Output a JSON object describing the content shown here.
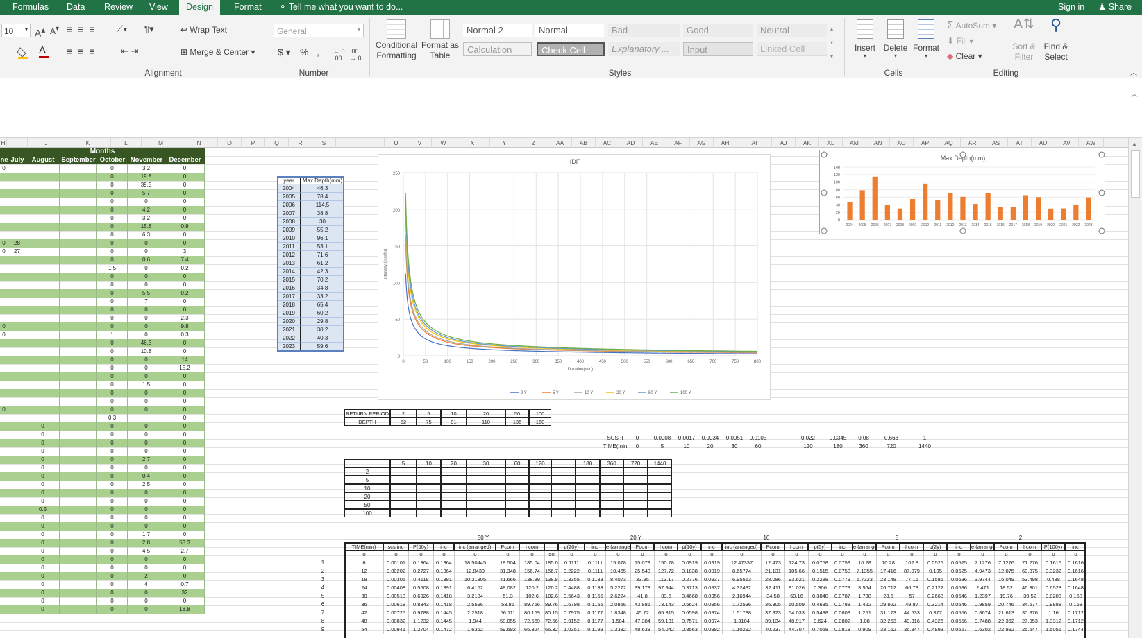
{
  "tabs": [
    "Formulas",
    "Data",
    "Review",
    "View",
    "Design",
    "Format"
  ],
  "tell_me": "Tell me what you want to do...",
  "sign_in": "Sign in",
  "share": "Share",
  "ribbon": {
    "font_size": "10",
    "wrap_text": "Wrap Text",
    "merge_center": "Merge & Center",
    "number_format": "General",
    "cond_format": [
      "Conditional",
      "Formatting"
    ],
    "format_table": [
      "Format as",
      "Table"
    ],
    "insert": "Insert",
    "delete": "Delete",
    "format": "Format",
    "autosum": "AutoSum",
    "fill": "Fill",
    "clear": "Clear",
    "sort_filter": [
      "Sort &",
      "Filter"
    ],
    "find_select": [
      "Find &",
      "Select"
    ],
    "groups": {
      "alignment": "Alignment",
      "number": "Number",
      "styles": "Styles",
      "cells": "Cells",
      "editing": "Editing"
    },
    "styles": [
      [
        "Normal 2",
        "Normal",
        "Bad",
        "Good",
        "Neutral"
      ],
      [
        "Calculation",
        "Check Cell",
        "Explanatory ...",
        "Input",
        "Linked Cell"
      ]
    ],
    "colors": {
      "bad": "#ffc7ce",
      "good": "#c6efce",
      "neutral": "#ffeb9c",
      "check": "#a5a5a5",
      "fill_icon": "#ffc000",
      "font_icon": "#c00000"
    }
  },
  "columns": [
    "H",
    "I",
    "J",
    "K",
    "L",
    "M",
    "N",
    "O",
    "P",
    "Q",
    "R",
    "S",
    "T",
    "U",
    "V",
    "W",
    "X",
    "Y",
    "Z",
    "AA",
    "AB",
    "AC",
    "AD",
    "AE",
    "AF",
    "AG",
    "AH",
    "AI",
    "AJ",
    "AK",
    "AL",
    "AM",
    "AN",
    "AO",
    "AP",
    "AQ",
    "AR",
    "AS",
    "AT",
    "AU",
    "AV",
    "AW"
  ],
  "months_table": {
    "title": "Months",
    "headers": [
      "ne",
      "July",
      "August",
      "September",
      "October",
      "November",
      "December"
    ],
    "rows": [
      [
        "0",
        "",
        "",
        "",
        "0",
        "3.2",
        "0"
      ],
      [
        "",
        "",
        "",
        "",
        "0",
        "19.8",
        "0"
      ],
      [
        "",
        "",
        "",
        "",
        "0",
        "39.5",
        "0"
      ],
      [
        "",
        "",
        "",
        "",
        "0",
        "5.7",
        "0"
      ],
      [
        "",
        "",
        "",
        "",
        "0",
        "0",
        "0"
      ],
      [
        "",
        "",
        "",
        "",
        "0",
        "4.2",
        "0"
      ],
      [
        "",
        "",
        "",
        "",
        "0",
        "3.2",
        "0"
      ],
      [
        "",
        "",
        "",
        "",
        "0",
        "15.8",
        "0.9"
      ],
      [
        "",
        "",
        "",
        "",
        "0",
        "6.3",
        "0"
      ],
      [
        "0",
        "28",
        "",
        "",
        "0",
        "0",
        "0"
      ],
      [
        "0",
        "27",
        "",
        "",
        "0",
        "0",
        "3"
      ],
      [
        "",
        "",
        "",
        "",
        "0",
        "0.6",
        "7.4"
      ],
      [
        "",
        "",
        "",
        "",
        "1.5",
        "0",
        "0.2"
      ],
      [
        "",
        "",
        "",
        "",
        "0",
        "0",
        "0"
      ],
      [
        "",
        "",
        "",
        "",
        "0",
        "0",
        "0"
      ],
      [
        "",
        "",
        "",
        "",
        "0",
        "5.5",
        "0.2"
      ],
      [
        "",
        "",
        "",
        "",
        "0",
        "7",
        "0"
      ],
      [
        "",
        "",
        "",
        "",
        "0",
        "0",
        "0"
      ],
      [
        "",
        "",
        "",
        "",
        "0",
        "0",
        "2.3"
      ],
      [
        "0",
        "",
        "",
        "",
        "0",
        "0",
        "9.8"
      ],
      [
        "0",
        "",
        "",
        "",
        "1",
        "0",
        "0.3"
      ],
      [
        "",
        "",
        "",
        "",
        "0",
        "46.3",
        "0"
      ],
      [
        "",
        "",
        "",
        "",
        "0",
        "10.8",
        "0"
      ],
      [
        "",
        "",
        "",
        "",
        "0",
        "0",
        "14"
      ],
      [
        "",
        "",
        "",
        "",
        "0",
        "0",
        "15.2"
      ],
      [
        "",
        "",
        "",
        "",
        "0",
        "0",
        "0"
      ],
      [
        "",
        "",
        "",
        "",
        "0",
        "1.5",
        "0"
      ],
      [
        "",
        "",
        "",
        "",
        "0",
        "0",
        "0"
      ],
      [
        "",
        "",
        "",
        "",
        "0",
        "0",
        "0"
      ],
      [
        "0",
        "",
        "",
        "",
        "0",
        "0",
        "0"
      ],
      [
        "",
        "",
        "",
        "",
        "0.3",
        "",
        "0"
      ],
      [
        "",
        "",
        "0",
        "",
        "0",
        "0",
        "0"
      ],
      [
        "",
        "",
        "0",
        "",
        "0",
        "0",
        "0"
      ],
      [
        "",
        "",
        "0",
        "",
        "0",
        "0",
        "0"
      ],
      [
        "",
        "",
        "0",
        "",
        "0",
        "0",
        "0"
      ],
      [
        "",
        "",
        "0",
        "",
        "0",
        "2.7",
        "0"
      ],
      [
        "",
        "",
        "0",
        "",
        "0",
        "0",
        "0"
      ],
      [
        "",
        "",
        "0",
        "",
        "0",
        "0.4",
        "0"
      ],
      [
        "",
        "",
        "0",
        "",
        "0",
        "2.5",
        "0"
      ],
      [
        "",
        "",
        "0",
        "",
        "0",
        "0",
        "0"
      ],
      [
        "",
        "",
        "0",
        "",
        "0",
        "0",
        "0"
      ],
      [
        "",
        "",
        "0.5",
        "",
        "0",
        "0",
        "0"
      ],
      [
        "",
        "",
        "0",
        "",
        "0",
        "0",
        "0"
      ],
      [
        "",
        "",
        "0",
        "",
        "0",
        "0",
        "0"
      ],
      [
        "",
        "",
        "0",
        "",
        "0",
        "1.7",
        "0"
      ],
      [
        "",
        "",
        "0",
        "",
        "0",
        "2.8",
        "53.3"
      ],
      [
        "",
        "",
        "0",
        "",
        "0",
        "4.5",
        "2.7"
      ],
      [
        "",
        "",
        "0",
        "",
        "0",
        "0",
        "0"
      ],
      [
        "",
        "",
        "0",
        "",
        "0",
        "0",
        "0"
      ],
      [
        "",
        "",
        "0",
        "",
        "0",
        "2",
        "0"
      ],
      [
        "",
        "",
        "0",
        "",
        "0",
        "4",
        "0.7"
      ],
      [
        "",
        "",
        "0",
        "",
        "0",
        "0",
        "32"
      ],
      [
        "",
        "",
        "0",
        "",
        "0",
        "0",
        "0"
      ],
      [
        "",
        "",
        "0",
        "",
        "0",
        "0",
        "18.8"
      ]
    ]
  },
  "maxdepth_table": {
    "headers": [
      "year",
      "Max Depth(mm)"
    ],
    "rows": [
      [
        "2004",
        "46.3"
      ],
      [
        "2005",
        "78.4"
      ],
      [
        "2006",
        "114.5"
      ],
      [
        "2007",
        "38.8"
      ],
      [
        "2008",
        "30"
      ],
      [
        "2009",
        "55.2"
      ],
      [
        "2010",
        "96.1"
      ],
      [
        "2011",
        "53.1"
      ],
      [
        "2012",
        "71.6"
      ],
      [
        "2013",
        "61.2"
      ],
      [
        "2014",
        "42.3"
      ],
      [
        "2015",
        "70.2"
      ],
      [
        "2016",
        "34.8"
      ],
      [
        "2017",
        "33.2"
      ],
      [
        "2018",
        "65.4"
      ],
      [
        "2019",
        "60.2"
      ],
      [
        "2020",
        "29.8"
      ],
      [
        "2021",
        "30.2"
      ],
      [
        "2022",
        "40.3"
      ],
      [
        "2023",
        "59.6"
      ]
    ]
  },
  "chart_data": [
    {
      "type": "line",
      "title": "IDF",
      "xlabel": "Duration(min)",
      "ylabel": "Intensity (mm/hr)",
      "xlim": [
        0,
        800
      ],
      "ylim": [
        0,
        250
      ],
      "x": [
        5,
        10,
        20,
        30,
        60,
        120,
        180,
        360,
        720,
        1440
      ],
      "series": [
        {
          "name": "2 Y",
          "color": "#4472c4",
          "values": [
            112,
            72,
            45,
            34,
            20,
            12,
            9,
            5.5,
            3,
            1.5
          ]
        },
        {
          "name": "5 Y",
          "color": "#ed7d31",
          "values": [
            155,
            99,
            62,
            47,
            28,
            16,
            12,
            7.5,
            4.5,
            2.5
          ]
        },
        {
          "name": "10 Y",
          "color": "#a5a5a5",
          "values": [
            165,
            106,
            67,
            50,
            30,
            17.5,
            13,
            8,
            5,
            2.7
          ]
        },
        {
          "name": "20 Y",
          "color": "#ffc000",
          "values": [
            190,
            122,
            77,
            58,
            34,
            20,
            15,
            9.3,
            5.7,
            3.1
          ]
        },
        {
          "name": "50 Y",
          "color": "#5b9bd5",
          "values": [
            205,
            132,
            83,
            62,
            37,
            21.5,
            16,
            10,
            6.2,
            3.4
          ]
        },
        {
          "name": "100 Y",
          "color": "#70ad47",
          "values": [
            222,
            143,
            90,
            67,
            40,
            23.5,
            17.5,
            11,
            6.7,
            3.7
          ]
        }
      ]
    },
    {
      "type": "bar",
      "title": "Max Depth(mm)",
      "ylim": [
        0,
        140
      ],
      "color": "#ed7d31",
      "categories": [
        "2004",
        "2005",
        "2006",
        "2007",
        "2008",
        "2009",
        "2010",
        "2011",
        "2012",
        "2013",
        "2014",
        "2015",
        "2016",
        "2017",
        "2018",
        "2019",
        "2020",
        "2021",
        "2022",
        "2023"
      ],
      "values": [
        46.3,
        78.4,
        114.5,
        38.8,
        30,
        55.2,
        96.1,
        53.1,
        71.6,
        61.2,
        42.3,
        70.2,
        34.8,
        33.2,
        65.4,
        60.2,
        29.8,
        30.2,
        40.3,
        59.6
      ]
    }
  ],
  "return_table": {
    "rows": [
      [
        "RETURN PERIOD",
        "2",
        "5",
        "10",
        "20",
        "50",
        "100"
      ],
      [
        "DEPTH",
        "52",
        "75",
        "91",
        "110",
        "135",
        "160"
      ]
    ]
  },
  "scs": {
    "rows": [
      [
        "SCS II",
        "0",
        "0.0008",
        "0.0017",
        "0.0034",
        "0.0051",
        "0.0105",
        "0.022",
        "0.0345",
        "0.08",
        "0.663",
        "1"
      ],
      [
        "TIME(min",
        "0",
        "5",
        "10",
        "20",
        "30",
        "60",
        "120",
        "180",
        "360",
        "720",
        "1440"
      ]
    ]
  },
  "idf_grid": {
    "header": [
      "",
      "5",
      "10",
      "20",
      "30",
      "60",
      "120",
      "",
      "180",
      "360",
      "720",
      "1440"
    ],
    "rows": [
      "2",
      "5",
      "10",
      "20",
      "50",
      "100"
    ]
  },
  "bottom": {
    "group_labels": [
      "50 Y",
      "20 Y",
      "10",
      "5",
      "2"
    ],
    "headers": [
      "TIME(min)",
      "scs inc",
      "P(50y)",
      "inc",
      "inc (arranged)",
      "Pcom",
      "I com",
      "",
      "p(20y)",
      "inc",
      "e (arrange",
      "Pcom",
      "I com",
      "p(10y)",
      "inc",
      "inc (arranged)",
      "Pcom",
      "I com",
      "p(5y)",
      "inc",
      "e (arrange",
      "Pcom",
      "I com",
      "p(2y)",
      "inc",
      "e (arrange",
      "Pcom",
      "I com",
      "P(100y)",
      "inc"
    ],
    "index": [
      "",
      "1",
      "2",
      "3",
      "4",
      "5",
      "6",
      "7",
      "8",
      "9"
    ],
    "rows": [
      [
        "0",
        "0",
        "0",
        "0",
        "0",
        "0",
        "0",
        "50",
        "0",
        "0",
        "0",
        "0",
        "0",
        "0",
        "0",
        "0",
        "0",
        "0",
        "0",
        "0",
        "0",
        "0",
        "0",
        "0",
        "0",
        "0",
        "0",
        "0",
        "0",
        "0"
      ],
      [
        "6",
        "0.00101",
        "0.1364",
        "0.1364",
        "18.50445",
        "18.504",
        "185.04",
        "185.04",
        "0.1111",
        "0.1111",
        "15.078",
        "15.078",
        "150.78",
        "0.0919",
        "0.0919",
        "12.47337",
        "12.473",
        "124.73",
        "0.0758",
        "0.0758",
        "10.28",
        "10.28",
        "102.8",
        "0.0525",
        "0.0525",
        "7.1276",
        "7.1276",
        "71.276",
        "0.1616",
        "0.1616"
      ],
      [
        "12",
        "0.00202",
        "0.2727",
        "0.1364",
        "12.8439",
        "31.348",
        "156.74",
        "156.74",
        "0.2222",
        "0.1111",
        "10.465",
        "25.543",
        "127.72",
        "0.1838",
        "0.0919",
        "8.65774",
        "21.131",
        "105.66",
        "0.1515",
        "0.0758",
        "7.1355",
        "17.416",
        "87.079",
        "0.105",
        "0.0525",
        "4.9473",
        "12.075",
        "60.375",
        "0.3232",
        "0.1616"
      ],
      [
        "18",
        "0.00305",
        "0.4118",
        "0.1391",
        "10.31805",
        "41.666",
        "138.89",
        "138.89",
        "0.3355",
        "0.1133",
        "8.4073",
        "33.95",
        "113.17",
        "0.2776",
        "0.0937",
        "6.95513",
        "28.086",
        "93.621",
        "0.2288",
        "0.0773",
        "5.7323",
        "23.148",
        "77.16",
        "0.1586",
        "0.0536",
        "3.9744",
        "16.049",
        "53.498",
        "0.488",
        "0.1648"
      ],
      [
        "24",
        "0.00408",
        "0.5508",
        "0.1391",
        "6.4152",
        "48.082",
        "120.2",
        "120.2",
        "0.4488",
        "0.1133",
        "5.2272",
        "39.178",
        "97.944",
        "0.3713",
        "0.0937",
        "4.32432",
        "32.411",
        "81.026",
        "0.306",
        "0.0773",
        "3.564",
        "26.712",
        "66.78",
        "0.2122",
        "0.0536",
        "2.471",
        "18.52",
        "46.301",
        "0.6528",
        "0.1648"
      ],
      [
        "30",
        "0.00513",
        "0.6926",
        "0.1418",
        "3.2184",
        "51.3",
        "102.6",
        "102.6",
        "0.5643",
        "0.1155",
        "2.6224",
        "41.8",
        "83.6",
        "0.4668",
        "0.0956",
        "2.16944",
        "34.58",
        "69.16",
        "0.3848",
        "0.0787",
        "1.788",
        "28.5",
        "57",
        "0.2668",
        "0.0546",
        "1.2397",
        "19.76",
        "39.52",
        "0.8208",
        "0.168"
      ],
      [
        "36",
        "0.00618",
        "0.8343",
        "0.1418",
        "2.5596",
        "53.86",
        "89.766",
        "89.766",
        "0.6798",
        "0.1155",
        "2.0856",
        "43.886",
        "73.143",
        "0.5624",
        "0.0956",
        "1.72536",
        "36.305",
        "60.509",
        "0.4635",
        "0.0788",
        "1.422",
        "29.922",
        "49.87",
        "0.3214",
        "0.0546",
        "0.9859",
        "20.746",
        "34.577",
        "0.9888",
        "0.168"
      ],
      [
        "42",
        "0.00725",
        "0.9788",
        "0.1445",
        "2.2518",
        "56.111",
        "80.159",
        "80.159",
        "0.7975",
        "0.1177",
        "1.8348",
        "45.72",
        "65.315",
        "0.6598",
        "0.0974",
        "1.51788",
        "37.823",
        "54.033",
        "0.5438",
        "0.0803",
        "1.251",
        "31.173",
        "44.533",
        "0.377",
        "0.0556",
        "0.8674",
        "21.613",
        "30.876",
        "1.16",
        "0.1712"
      ],
      [
        "48",
        "0.00832",
        "1.1232",
        "0.1445",
        "1.944",
        "58.055",
        "72.569",
        "72.569",
        "0.9152",
        "0.1177",
        "1.584",
        "47.304",
        "59.131",
        "0.7571",
        "0.0974",
        "1.3104",
        "39.134",
        "48.917",
        "0.624",
        "0.0802",
        "1.08",
        "32.253",
        "40.316",
        "0.4326",
        "0.0556",
        "0.7488",
        "22.362",
        "27.953",
        "1.3312",
        "0.1712"
      ],
      [
        "54",
        "0.00941",
        "1.2704",
        "0.1472",
        "1.6362",
        "59.692",
        "66.324",
        "66.324",
        "1.0351",
        "0.1199",
        "1.3332",
        "48.638",
        "54.042",
        "0.8563",
        "0.0992",
        "1.10292",
        "40.237",
        "44.707",
        "0.7058",
        "0.0818",
        "0.909",
        "33.162",
        "36.847",
        "0.4893",
        "0.0567",
        "0.6302",
        "22.992",
        "25.547",
        "1.5056",
        "0.1744"
      ]
    ]
  }
}
